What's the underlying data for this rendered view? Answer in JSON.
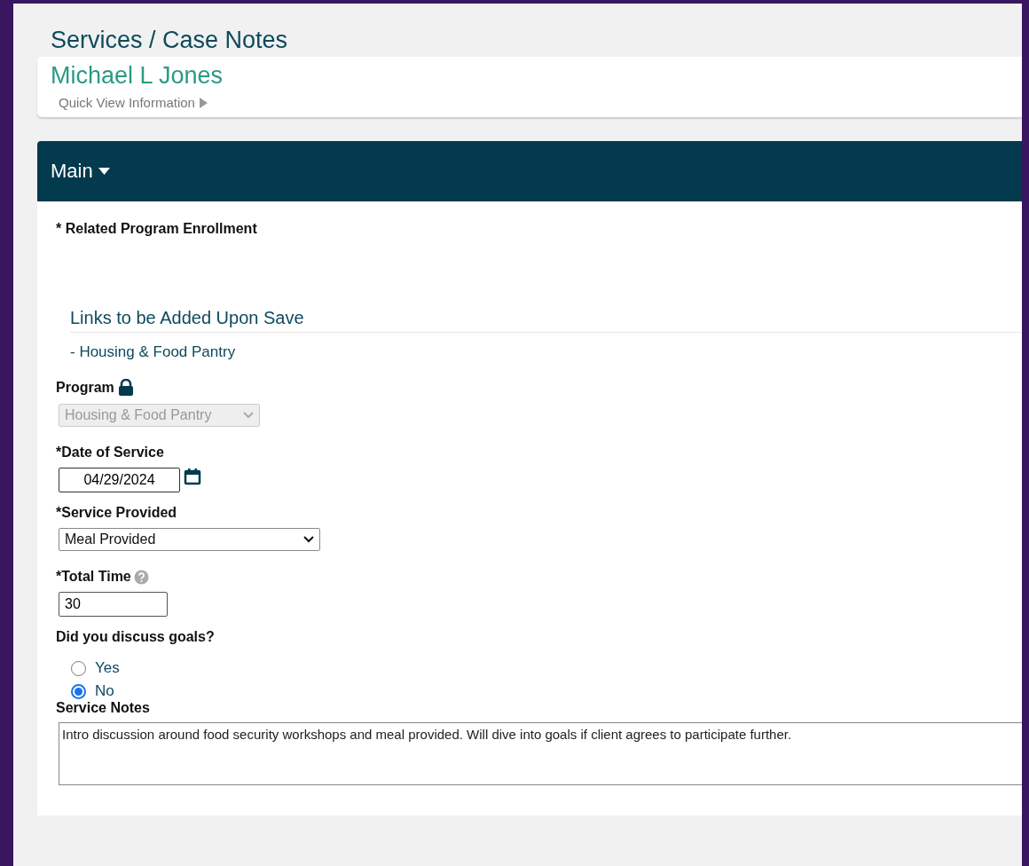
{
  "page": {
    "title": "Services / Case Notes"
  },
  "client": {
    "name": "Michael L Jones",
    "quick_view": "Quick View Information"
  },
  "section": {
    "title": "Main",
    "expanded": true
  },
  "form": {
    "enrollment_label": "* Related Program Enrollment",
    "links_heading": "Links to be Added Upon Save",
    "links": [
      "- Housing & Food Pantry"
    ],
    "program": {
      "label": "Program",
      "value": "Housing & Food Pantry",
      "disabled": true
    },
    "date": {
      "label": "*Date of Service",
      "value": "04/29/2024"
    },
    "service": {
      "label": "*Service Provided",
      "value": "Meal Provided"
    },
    "total_time": {
      "label": "*Total Time",
      "value": "30"
    },
    "goals": {
      "label": "Did you discuss goals?",
      "options": [
        {
          "label": "Yes",
          "selected": false
        },
        {
          "label": "No",
          "selected": true
        }
      ]
    },
    "notes": {
      "label": "Service Notes",
      "value": "Intro discussion around food security workshops and meal provided. Will dive into goals if client agrees to participate further."
    }
  }
}
